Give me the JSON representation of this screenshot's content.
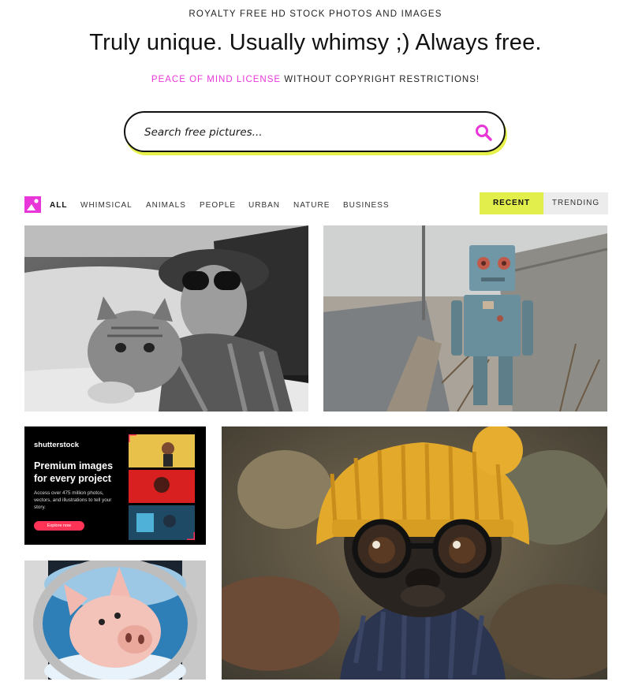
{
  "header": {
    "eyebrow": "ROYALTY FREE HD STOCK PHOTOS AND IMAGES",
    "headline": "Truly unique. Usually whimsy ;) Always free.",
    "license_highlight": "PEACE OF MIND LICENSE",
    "license_rest": " WITHOUT COPYRIGHT RESTRICTIONS!"
  },
  "search": {
    "placeholder": "Search free pictures...",
    "icon": "search-icon"
  },
  "categories": [
    {
      "label": "ALL",
      "active": true
    },
    {
      "label": "WHIMSICAL",
      "active": false
    },
    {
      "label": "ANIMALS",
      "active": false
    },
    {
      "label": "PEOPLE",
      "active": false
    },
    {
      "label": "URBAN",
      "active": false
    },
    {
      "label": "NATURE",
      "active": false
    },
    {
      "label": "BUSINESS",
      "active": false
    }
  ],
  "sort": {
    "recent": "RECENT",
    "trending": "TRENDING",
    "selected": "RECENT"
  },
  "colors": {
    "accent_pink": "#e836d8",
    "accent_yellow": "#e2ee4c",
    "ad_cta": "#ff3355"
  },
  "ad": {
    "brand": "shutterstock",
    "title": "Premium images for every project",
    "body": "Access over 475 million photos, vectors, and illustrations to tell your story.",
    "cta": "Explore now"
  },
  "gallery": [
    {
      "subject": "woman-with-cat-in-car-photo"
    },
    {
      "subject": "rusty-robot-roadside-photo"
    },
    {
      "subject": "dog-with-glasses-beanie-photo"
    },
    {
      "subject": "pig-airplane-window-photo"
    }
  ]
}
